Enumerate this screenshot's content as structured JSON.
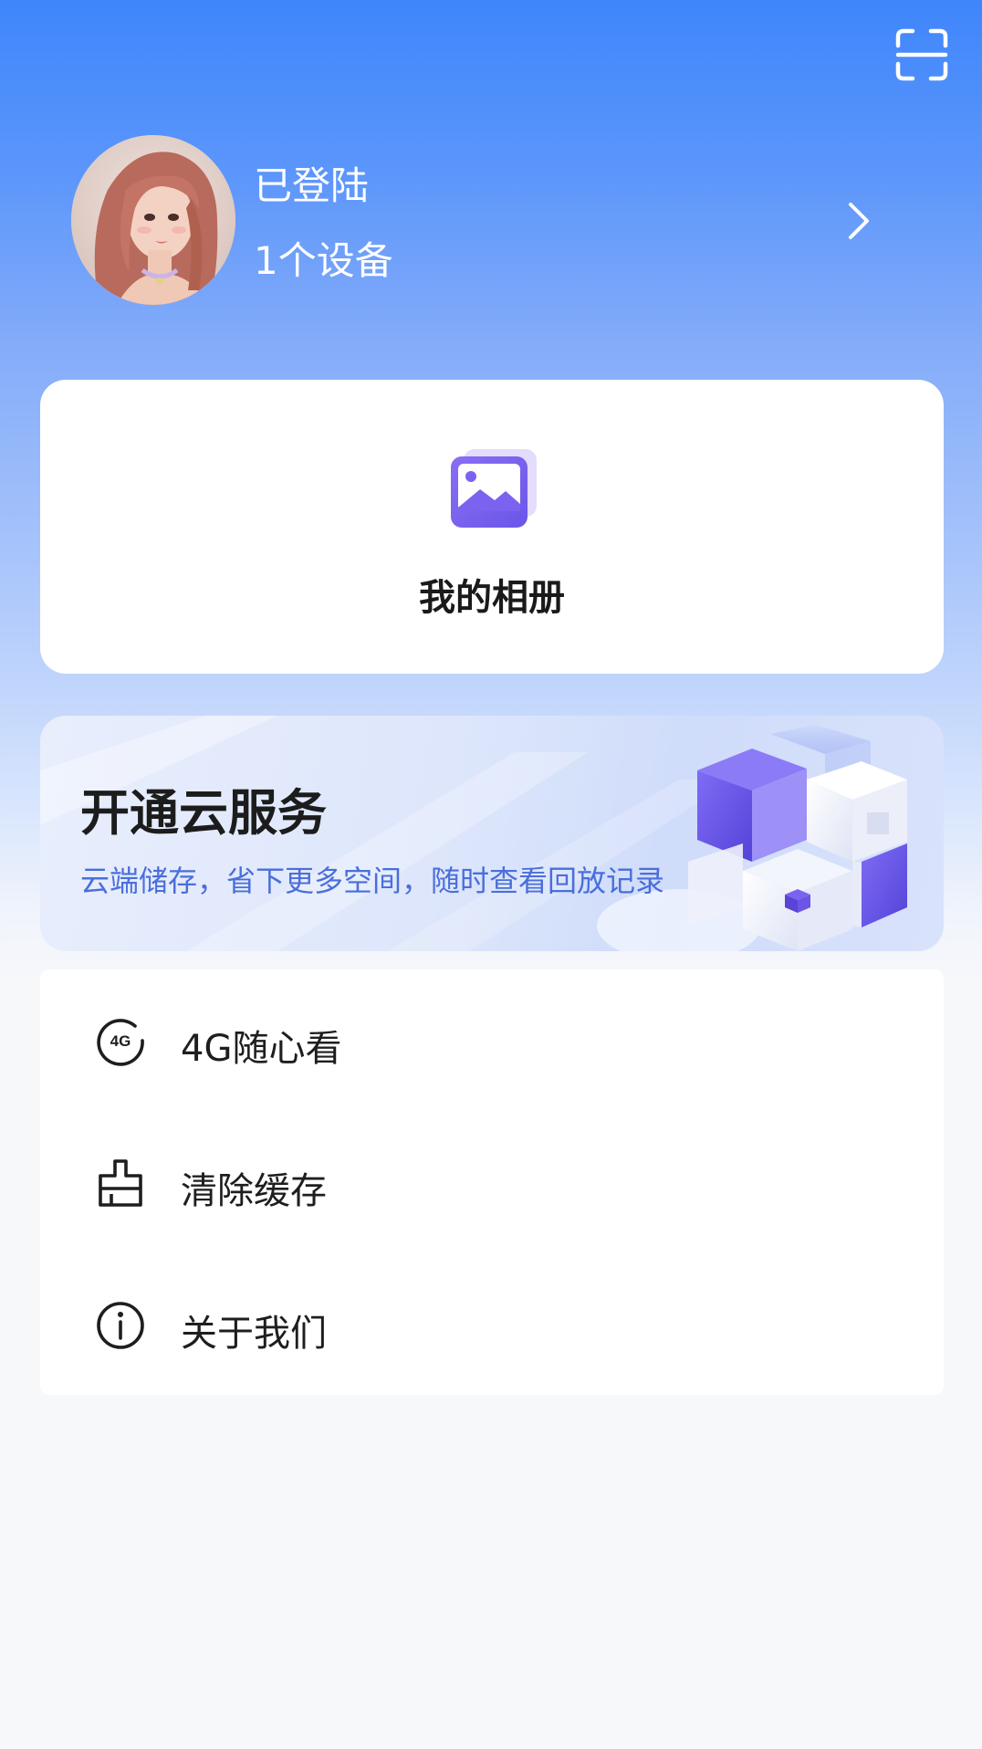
{
  "header": {
    "scan_icon": "scan-icon"
  },
  "profile": {
    "status": "已登陆",
    "devices": "1个设备",
    "chevron_icon": "chevron-right-icon"
  },
  "album": {
    "icon": "photo-album-icon",
    "label": "我的相册"
  },
  "cloud": {
    "title": "开通云服务",
    "subtitle": "云端储存，省下更多空间，随时查看回放记录"
  },
  "menu": {
    "items": [
      {
        "icon": "4g-icon",
        "label": "4G随心看"
      },
      {
        "icon": "broom-icon",
        "label": "清除缓存"
      },
      {
        "icon": "info-icon",
        "label": "关于我们"
      }
    ]
  },
  "colors": {
    "header_blue": "#3f86fb",
    "accent_purple": "#7b63f0",
    "subtitle_blue": "#4a6edb",
    "page_bg": "#f7f8fa"
  }
}
